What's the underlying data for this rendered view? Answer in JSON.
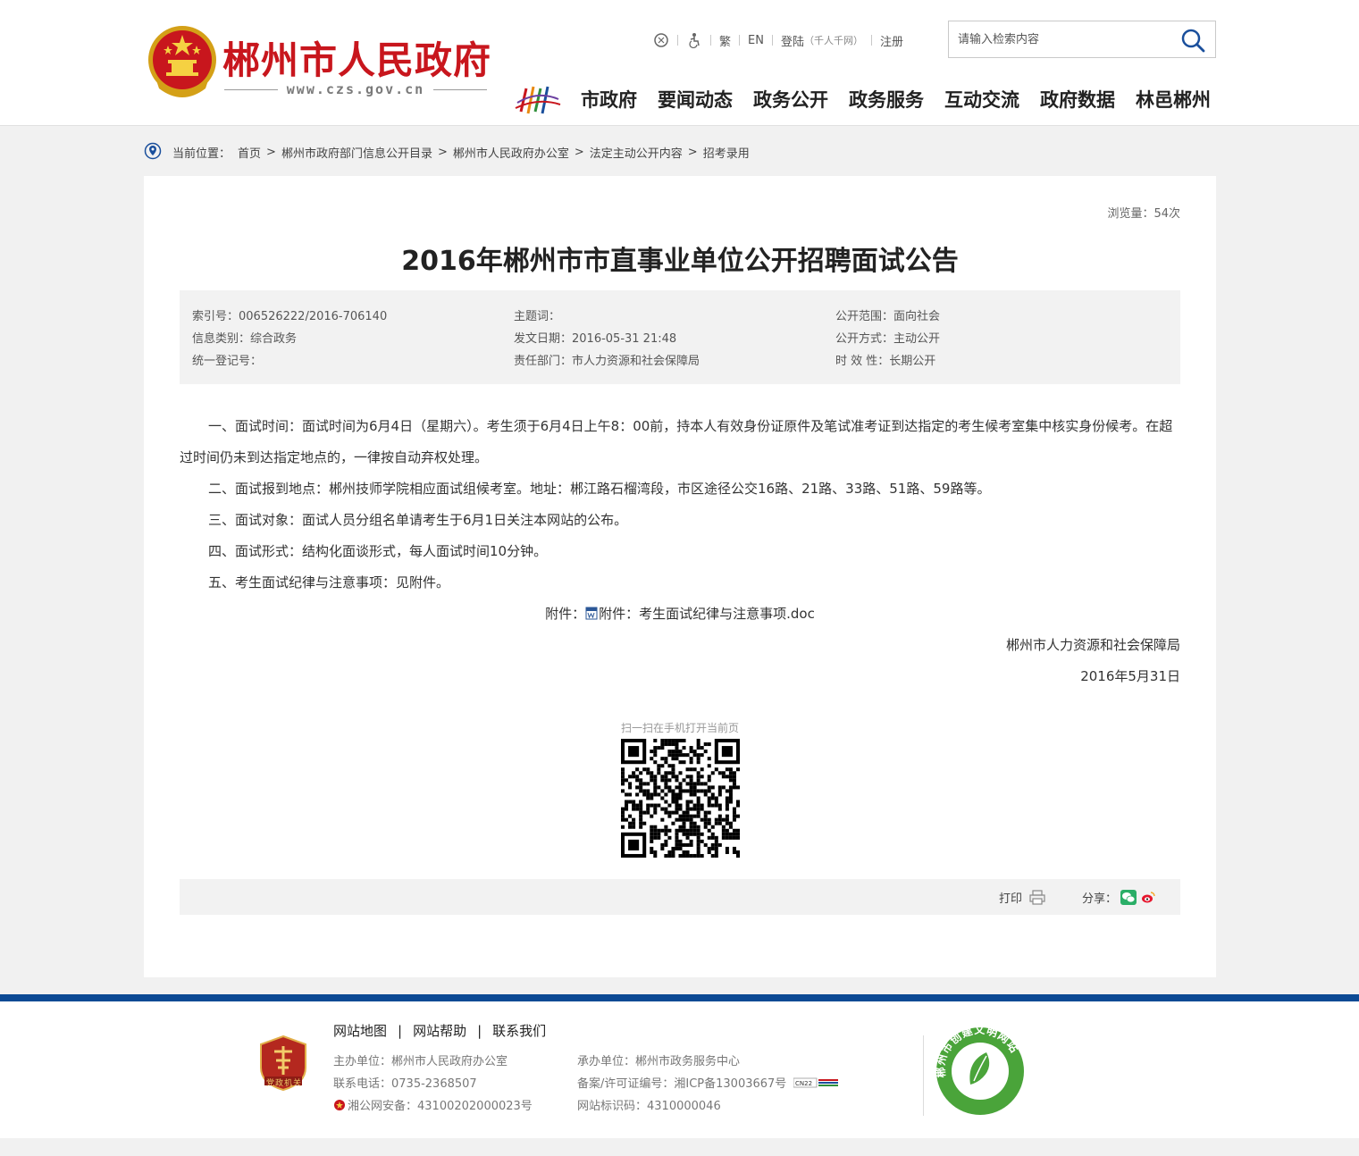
{
  "header": {
    "site_title": "郴州市人民政府",
    "site_url": "www.czs.gov.cn",
    "toplinks": {
      "traditional": "繁",
      "english": "EN",
      "login": "登陆",
      "login_note": "（千人千网）",
      "register": "注册"
    },
    "search": {
      "placeholder": "请输入检索内容"
    },
    "nav": [
      "市政府",
      "要闻动态",
      "政务公开",
      "政务服务",
      "互动交流",
      "政府数据",
      "林邑郴州"
    ]
  },
  "breadcrumb": {
    "label": "当前位置：",
    "items": [
      "首页",
      "郴州市政府部门信息公开目录",
      "郴州市人民政府办公室",
      "法定主动公开内容",
      "招考录用"
    ]
  },
  "article": {
    "views": "浏览量：54次",
    "title": "2016年郴州市市直事业单位公开招聘面试公告",
    "meta": {
      "index_no": "索引号：006526222/2016-706140",
      "category": "信息类别：综合政务",
      "reg_no": "统一登记号：",
      "subject": "主题词：",
      "issue_date": "发文日期：2016-05-31 21:48",
      "department": "责任部门：市人力资源和社会保障局",
      "scope": "公开范围：面向社会",
      "method": "公开方式：主动公开",
      "validity": "时 效 性：长期公开"
    },
    "paragraphs": [
      "一、面试时间：面试时间为6月4日（星期六）。考生须于6月4日上午8：00前，持本人有效身份证原件及笔试准考证到达指定的考生候考室集中核实身份候考。在超过时间仍未到达指定地点的，一律按自动弃权处理。",
      "二、面试报到地点：郴州技师学院相应面试组候考室。地址：郴江路石榴湾段，市区途径公交16路、21路、33路、51路、59路等。",
      "三、面试对象：面试人员分组名单请考生于6月1日关注本网站的公布。",
      "四、面试形式：结构化面谈形式，每人面试时间10分钟。",
      "五、考生面试纪律与注意事项：见附件。"
    ],
    "attachment_label": "附件：",
    "attachment_link": "附件：考生面试纪律与注意事项.doc",
    "signature": "郴州市人力资源和社会保障局",
    "date": "2016年5月31日",
    "qr_caption": "扫一扫在手机打开当前页",
    "print_label": "打印",
    "share_label": "分享："
  },
  "footer": {
    "links": [
      "网站地图",
      "网站帮助",
      "联系我们"
    ],
    "sponsor": "主办单位：郴州市人民政府办公室",
    "phone": "联系电话：0735-2368507",
    "police": "湘公网安备：43100202000023号",
    "undertaker": "承办单位：郴州市政务服务中心",
    "icp": "备案/许可证编号：湘ICP备13003667号",
    "site_id": "网站标识码：4310000046",
    "party_badge": "党政机关",
    "civil_badge": "郴州市创建文明网站"
  },
  "colors": {
    "brand_red": "#c8161d",
    "footer_blue": "#0c4a94"
  }
}
